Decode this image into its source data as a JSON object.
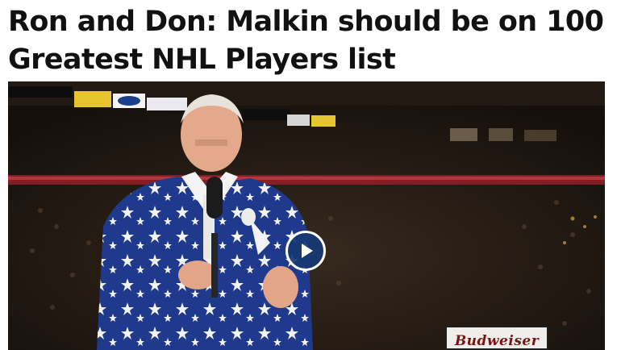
{
  "article": {
    "headline_line1": "Ron and Don: Malkin should be on 100",
    "headline_line2": "Greatest NHL Players list"
  },
  "video": {
    "play_icon": "play-icon",
    "sponsor_text": "Budweiser"
  }
}
